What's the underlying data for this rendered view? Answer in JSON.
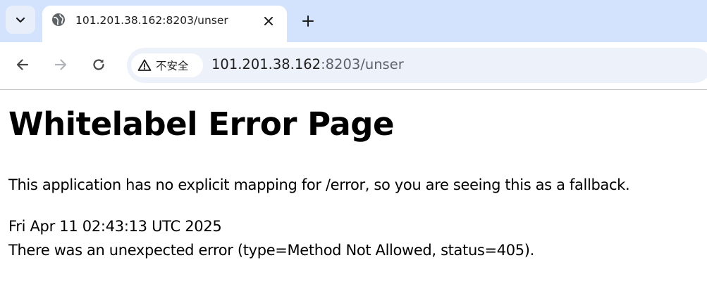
{
  "browser": {
    "tab": {
      "title": "101.201.38.162:8203/unser"
    },
    "address_bar": {
      "security_label": "不安全",
      "url_host": "101.201.38.162",
      "url_rest": ":8203/unser"
    }
  },
  "page": {
    "heading": "Whitelabel Error Page",
    "message": "This application has no explicit mapping for /error, so you are seeing this as a fallback.",
    "timestamp": "Fri Apr 11 02:43:13 UTC 2025",
    "error_detail": "There was an unexpected error (type=Method Not Allowed, status=405)."
  },
  "icons": {
    "tab_search": "chevron-down-icon",
    "favicon": "globe-icon",
    "tab_close": "close-icon",
    "new_tab": "plus-icon",
    "back": "arrow-left-icon",
    "forward": "arrow-right-icon",
    "reload": "reload-icon",
    "security": "warning-triangle-icon"
  },
  "colors": {
    "tabstrip_bg": "#d3e3fd",
    "omnibox_bg": "#edf2fa",
    "icon": "#474747",
    "icon_disabled": "#b0b4b9"
  }
}
